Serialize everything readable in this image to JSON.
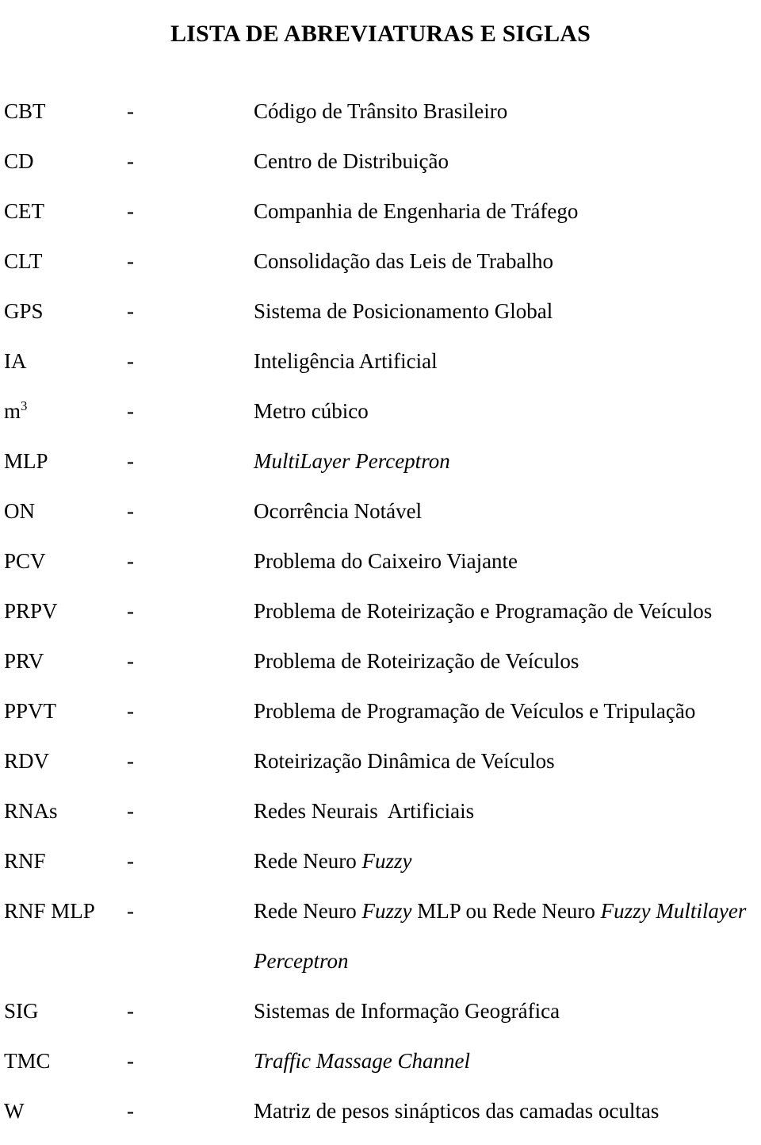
{
  "document": {
    "title": "LISTA DE ABREVIATURAS E SIGLAS",
    "separator": "-",
    "entries": [
      {
        "term": "CBT",
        "term_style": "roman",
        "dash": "-",
        "definition": "Código de Trânsito Brasileiro",
        "def_style": "roman"
      },
      {
        "term": "CD",
        "term_style": "roman",
        "dash": "-",
        "definition": "Centro de Distribuição",
        "def_style": "roman"
      },
      {
        "term": "CET",
        "term_style": "roman",
        "dash": "-",
        "definition": "Companhia de Engenharia de Tráfego",
        "def_style": "roman"
      },
      {
        "term": "CLT",
        "term_style": "roman",
        "dash": "-",
        "definition": "Consolidação das Leis de Trabalho",
        "def_style": "roman"
      },
      {
        "term": "GPS",
        "term_style": "roman",
        "dash": "-",
        "definition": "Sistema de Posicionamento Global",
        "def_style": "roman"
      },
      {
        "term": "IA",
        "term_style": "roman",
        "dash": "-",
        "definition": "Inteligência Artificial",
        "def_style": "roman"
      },
      {
        "term": "m³",
        "term_style": "roman",
        "dash": "-",
        "definition": "Metro cúbico",
        "def_style": "roman",
        "term_superscript": {
          "base": "m",
          "sup": "3"
        }
      },
      {
        "term": "MLP",
        "term_style": "roman",
        "dash": "-",
        "definition": "MultiLayer Perceptron",
        "def_style": "italic"
      },
      {
        "term": "ON",
        "term_style": "roman",
        "dash": "-",
        "definition": "Ocorrência Notável",
        "def_style": "roman"
      },
      {
        "term": "PCV",
        "term_style": "roman",
        "dash": "-",
        "definition": "Problema do Caixeiro Viajante",
        "def_style": "roman"
      },
      {
        "term": "PRPV",
        "term_style": "roman",
        "dash": "-",
        "definition": "Problema de Roteirização e Programação de Veículos",
        "def_style": "roman"
      },
      {
        "term": "PRV",
        "term_style": "roman",
        "dash": "-",
        "definition": "Problema de Roteirização de Veículos",
        "def_style": "roman"
      },
      {
        "term": "PPVT",
        "term_style": "roman",
        "dash": "-",
        "definition": "Problema de Programação de Veículos e Tripulação",
        "def_style": "roman"
      },
      {
        "term": "RDV",
        "term_style": "roman",
        "dash": "-",
        "definition": "Roteirização Dinâmica de Veículos",
        "def_style": "roman"
      },
      {
        "term": "RNAs",
        "term_style": "roman",
        "dash": "-",
        "definition": "Redes Neurais  Artificiais",
        "def_style": "roman"
      },
      {
        "term": "RNF",
        "term_style": "roman",
        "dash": "-",
        "definition": "Rede Neuro Fuzzy",
        "def_style": "mixed",
        "def_parts": [
          {
            "text": "Rede Neuro ",
            "style": "roman"
          },
          {
            "text": "Fuzzy",
            "style": "italic"
          }
        ]
      },
      {
        "term": "RNF MLP",
        "term_style": "roman",
        "dash": "-",
        "definition": "Rede Neuro Fuzzy MLP ou Rede Neuro Fuzzy Multilayer",
        "def_style": "mixed",
        "def_parts": [
          {
            "text": "Rede Neuro ",
            "style": "roman"
          },
          {
            "text": "Fuzzy",
            "style": "italic"
          },
          {
            "text": " MLP ou Rede Neuro ",
            "style": "roman"
          },
          {
            "text": "Fuzzy Multilayer",
            "style": "italic"
          }
        ],
        "continuation": "Perceptron",
        "continuation_style": "italic"
      },
      {
        "term": "SIG",
        "term_style": "roman",
        "dash": "-",
        "definition": "Sistemas de Informação Geográfica",
        "def_style": "roman"
      },
      {
        "term": "TMC",
        "term_style": "roman",
        "dash": "-",
        "definition": "Traffic Massage Channel",
        "def_style": "italic"
      },
      {
        "term": "W",
        "term_style": "roman",
        "dash": "-",
        "definition": "Matriz de pesos sinápticos das camadas ocultas",
        "def_style": "roman"
      }
    ]
  },
  "colors": {
    "page_background": "#ffffff",
    "text": "#000000"
  }
}
